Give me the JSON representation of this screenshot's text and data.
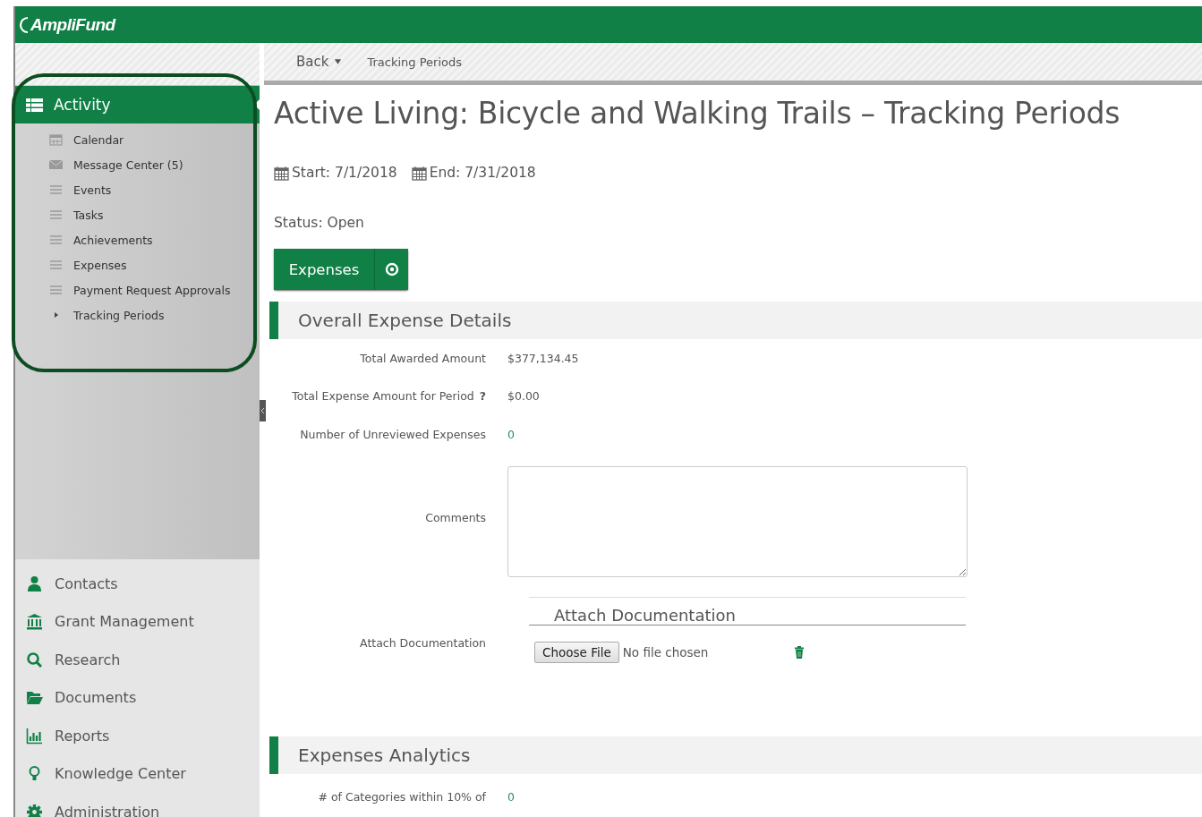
{
  "header": {
    "logo": "AmpliFund"
  },
  "breadcrumb": {
    "back": "Back",
    "current": "Tracking Periods"
  },
  "sidebar": {
    "activity": {
      "label": "Activity",
      "expanded": true,
      "items": [
        {
          "label": "Calendar",
          "kind": "calendar"
        },
        {
          "label": "Message Center (5)",
          "kind": "envelope"
        },
        {
          "label": "Events",
          "kind": "lines"
        },
        {
          "label": "Tasks",
          "kind": "lines"
        },
        {
          "label": "Achievements",
          "kind": "lines"
        },
        {
          "label": "Expenses",
          "kind": "lines"
        },
        {
          "label": "Payment Request Approvals",
          "kind": "lines"
        },
        {
          "label": "Tracking Periods",
          "kind": "caret"
        }
      ]
    },
    "nav": [
      {
        "label": "Contacts",
        "kind": "user"
      },
      {
        "label": "Grant Management",
        "kind": "bank"
      },
      {
        "label": "Research",
        "kind": "search"
      },
      {
        "label": "Documents",
        "kind": "folder"
      },
      {
        "label": "Reports",
        "kind": "chart"
      },
      {
        "label": "Knowledge Center",
        "kind": "bulb"
      },
      {
        "label": "Administration",
        "kind": "gear"
      }
    ]
  },
  "page": {
    "title": "Active Living: Bicycle and Walking Trails – Tracking Periods",
    "dates": [
      "Start: 7/1/2018",
      "End: 7/31/2018"
    ],
    "status": "Status: Open",
    "action_button": {
      "label": "Expenses"
    },
    "sections": [
      {
        "title": "Overall Expense Details",
        "fields": [
          {
            "kind": "text",
            "label": "Total Awarded Amount",
            "value": "$377,134.45"
          },
          {
            "kind": "text",
            "label": "Total Expense Amount for Period",
            "help": "?",
            "value": "$0.00"
          },
          {
            "kind": "count",
            "label": "Number of Unreviewed Expenses",
            "value": "0"
          },
          {
            "kind": "textarea",
            "label": "Comments"
          },
          {
            "kind": "file",
            "label": "Attach Documentation",
            "panel_title": "Attach Documentation",
            "button": "Choose File",
            "file_status": "No file chosen"
          }
        ]
      },
      {
        "title": "Expenses Analytics",
        "fields": [
          {
            "kind": "count",
            "label": "# of Categories within 10% of",
            "value": "0"
          }
        ]
      }
    ]
  }
}
